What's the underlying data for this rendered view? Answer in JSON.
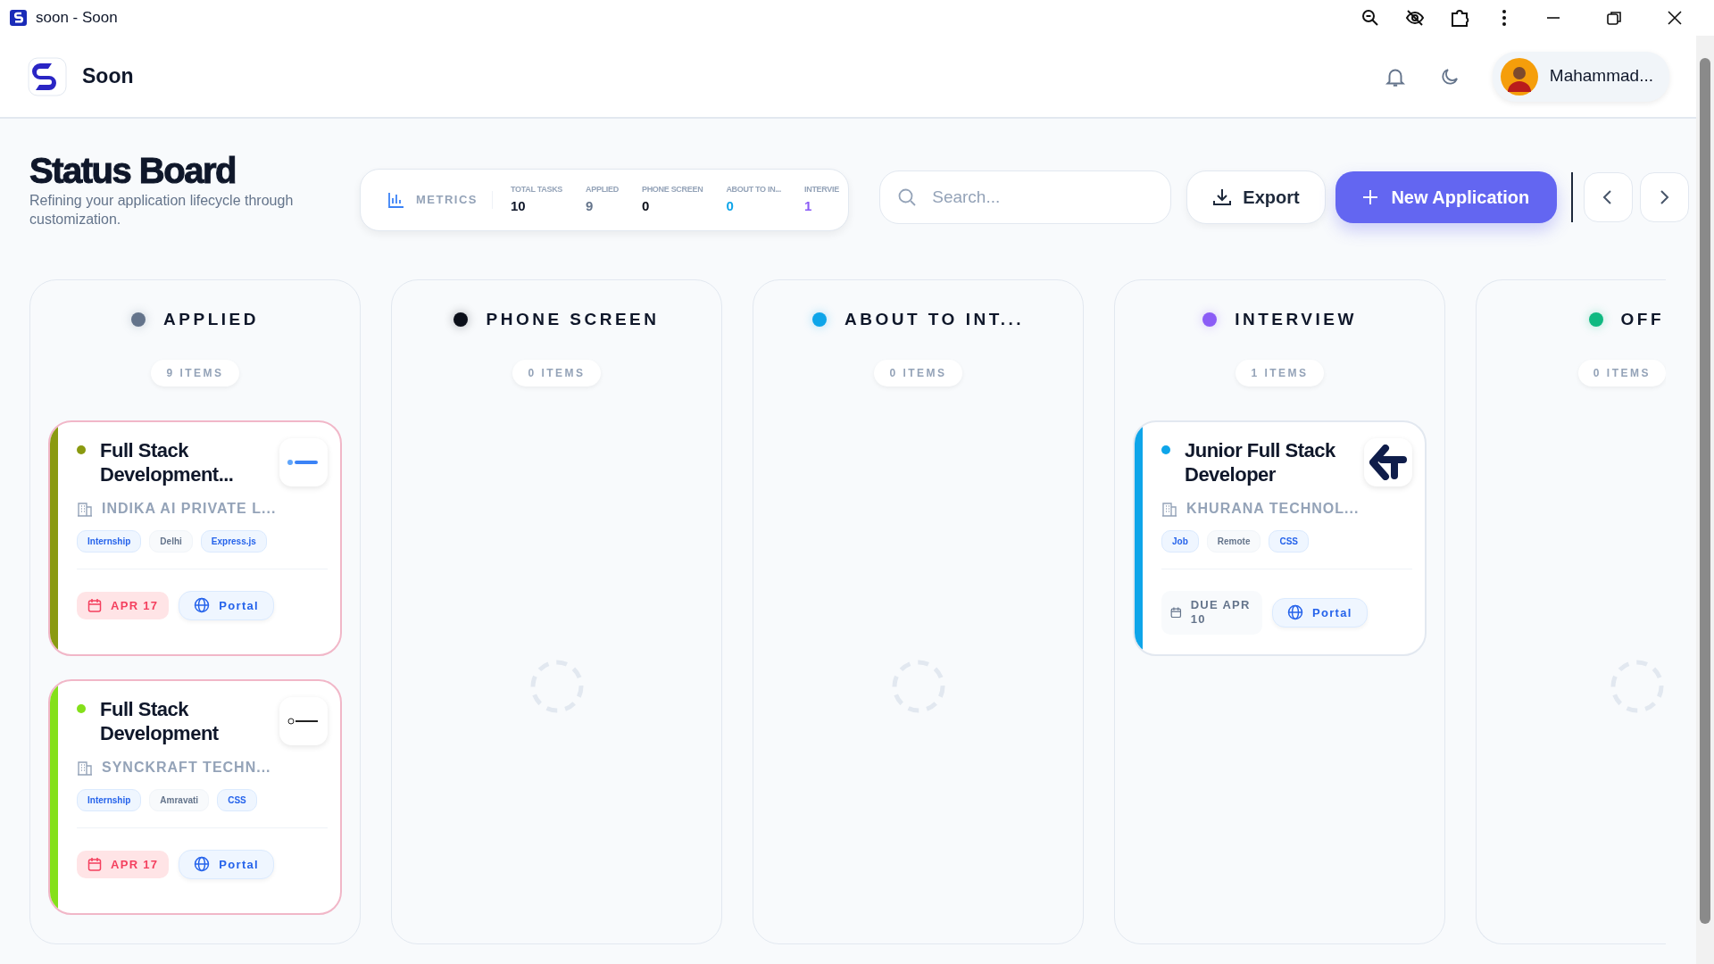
{
  "window": {
    "title": "soon - Soon"
  },
  "app": {
    "name": "Soon",
    "user": "Mahammad..."
  },
  "page": {
    "title": "Status Board",
    "subtitle": "Refining your application lifecycle through customization."
  },
  "metrics": {
    "label": "METRICS",
    "items": [
      {
        "label": "TOTAL TASKS",
        "value": "10",
        "color": "#0f172a"
      },
      {
        "label": "APPLIED",
        "value": "9",
        "color": "#64748b"
      },
      {
        "label": "PHONE SCREEN",
        "value": "0",
        "color": "#0b0f19"
      },
      {
        "label": "ABOUT TO IN...",
        "value": "0",
        "color": "#0ea5e9"
      },
      {
        "label": "INTERVIE",
        "value": "1",
        "color": "#8b5cf6"
      }
    ]
  },
  "search": {
    "placeholder": "Search..."
  },
  "buttons": {
    "export": "Export",
    "new": "New Application"
  },
  "columns": [
    {
      "title": "APPLIED",
      "color": "#64748b",
      "count": "9 ITEMS",
      "cards": [
        {
          "title": "Full Stack Development...",
          "company": "INDIKA AI PRIVATE L...",
          "color": "#8a9a10",
          "overdue": true,
          "logo": {
            "kind": "wordmark"
          },
          "tags": [
            {
              "text": "Internship",
              "kind": "type"
            },
            {
              "text": "Delhi",
              "kind": "location"
            },
            {
              "text": "Express.js",
              "kind": "skill"
            }
          ],
          "date": "APR 17",
          "link": "Portal"
        },
        {
          "title": "Full Stack Development",
          "company": "SYNCKRAFT TECHN...",
          "color": "#84e01a",
          "overdue": true,
          "logo": {
            "kind": "mark"
          },
          "tags": [
            {
              "text": "Internship",
              "kind": "type"
            },
            {
              "text": "Amravati",
              "kind": "location"
            },
            {
              "text": "CSS",
              "kind": "skill"
            }
          ],
          "date": "APR 17",
          "link": "Portal"
        }
      ]
    },
    {
      "title": "PHONE SCREEN",
      "color": "#0b0f19",
      "count": "0 ITEMS",
      "loading": true
    },
    {
      "title": "ABOUT TO INT...",
      "color": "#0ea5e9",
      "count": "0 ITEMS",
      "loading": true
    },
    {
      "title": "INTERVIEW",
      "color": "#8b5cf6",
      "count": "1 ITEMS",
      "cards": [
        {
          "title": "Junior Full Stack Developer",
          "company": "KHURANA TECHNOL...",
          "color": "#0ea5e9",
          "overdue": false,
          "logo": {
            "kind": "arrow"
          },
          "tags": [
            {
              "text": "Job",
              "kind": "type"
            },
            {
              "text": "Remote",
              "kind": "location"
            },
            {
              "text": "CSS",
              "kind": "skill"
            }
          ],
          "date": "DUE APR 10",
          "link": "Portal"
        }
      ]
    },
    {
      "title": "OFF",
      "color": "#10b981",
      "count": "0 ITEMS",
      "loading": true
    }
  ]
}
